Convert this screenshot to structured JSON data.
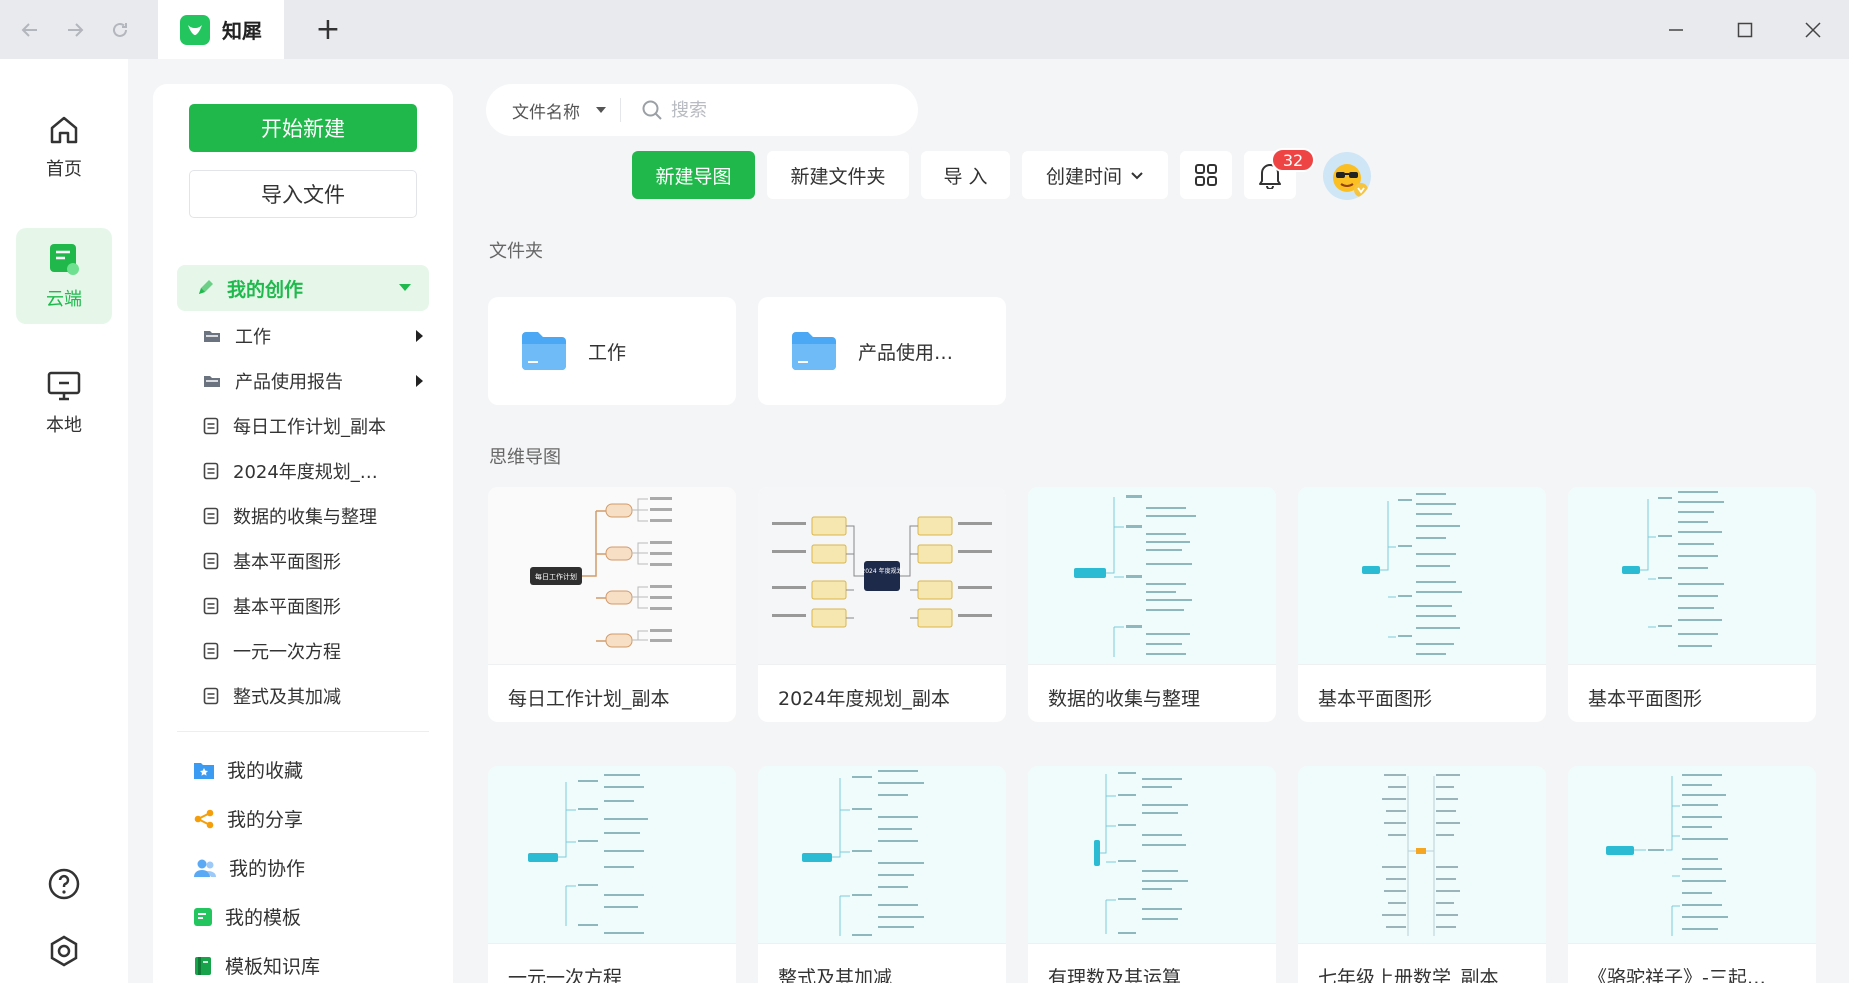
{
  "app": {
    "title": "知犀"
  },
  "rail": {
    "items": [
      {
        "label": "首页",
        "icon": "home-icon"
      },
      {
        "label": "云端",
        "icon": "cloud-doc-icon"
      },
      {
        "label": "本地",
        "icon": "monitor-icon"
      }
    ],
    "active": "云端"
  },
  "sidebar": {
    "start_new": "开始新建",
    "import_file": "导入文件",
    "my_creations": "我的创作",
    "tree": [
      {
        "label": "工作",
        "type": "folder"
      },
      {
        "label": "产品使用报告",
        "type": "folder"
      },
      {
        "label": "每日工作计划_副本",
        "type": "file"
      },
      {
        "label": "2024年度规划_…",
        "type": "file"
      },
      {
        "label": "数据的收集与整理",
        "type": "file"
      },
      {
        "label": "基本平面图形",
        "type": "file"
      },
      {
        "label": "基本平面图形",
        "type": "file"
      },
      {
        "label": "一元一次方程",
        "type": "file"
      },
      {
        "label": "整式及其加减",
        "type": "file"
      }
    ],
    "links": [
      {
        "label": "我的收藏",
        "icon": "favorites-icon"
      },
      {
        "label": "我的分享",
        "icon": "share-icon"
      },
      {
        "label": "我的协作",
        "icon": "collaborate-icon"
      },
      {
        "label": "我的模板",
        "icon": "template-icon"
      },
      {
        "label": "模板知识库",
        "icon": "book-icon"
      }
    ]
  },
  "search": {
    "filter": "文件名称",
    "placeholder": "搜索"
  },
  "toolbar": {
    "new_map": "新建导图",
    "new_folder": "新建文件夹",
    "import": "导 入",
    "sort": "创建时间",
    "notifications": "32"
  },
  "sections": {
    "folders": "文件夹",
    "maps": "思维导图"
  },
  "folders": [
    "工作",
    "产品使用…"
  ],
  "maps": [
    "每日工作计划_副本",
    "2024年度规划_副本",
    "数据的收集与整理",
    "基本平面图形",
    "基本平面图形",
    "一元一次方程",
    "整式及其加减",
    "有理数及其运算",
    "七年级上册数学_副本",
    "《骆驼祥子》-三起…"
  ],
  "thumbnail_texts": {
    "daily_plan_root": "每日工作计划",
    "plan_2024_root": "2024 年度规划"
  },
  "colors": {
    "brand": "#20b84a",
    "brand_light": "#e6f7ea",
    "badge": "#ef4444",
    "folder": "#4aa8f5"
  }
}
